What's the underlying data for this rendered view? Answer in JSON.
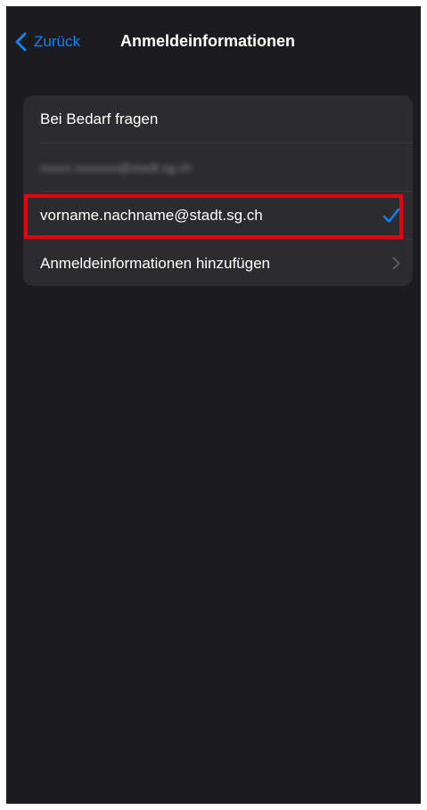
{
  "nav": {
    "back_label": "Zurück",
    "title": "Anmeldeinformationen",
    "back_icon": "chevron-left-icon"
  },
  "options": {
    "items": [
      {
        "label": "Bei Bedarf fragen",
        "selected": false
      },
      {
        "label": "xxxxx.xxxxxxx@stadt.sg.ch",
        "selected": false,
        "blurred": true
      },
      {
        "label": "vorname.nachname@stadt.sg.ch",
        "selected": true,
        "highlighted": true
      },
      {
        "label": "Anmeldeinformationen hinzufügen",
        "selected": false,
        "trailing_icon": "chevron-right-icon"
      }
    ]
  },
  "colors": {
    "background": "#1c1c1e",
    "group": "#2c2c2e",
    "accent": "#0a84ff",
    "highlight": "#e8000b",
    "text": "#ffffff",
    "chevron": "#5a5a5e"
  }
}
